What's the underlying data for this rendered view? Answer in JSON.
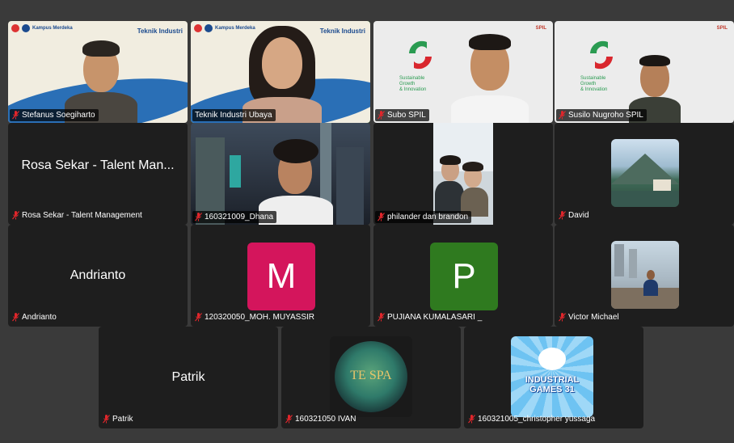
{
  "participants": [
    {
      "name": "Stefanus Soegiharto",
      "muted": true
    },
    {
      "name": "Teknik Industri Ubaya",
      "muted": false
    },
    {
      "name": "Subo SPIL",
      "muted": true
    },
    {
      "name": "Susilo Nugroho SPIL",
      "muted": true
    },
    {
      "name": "Rosa Sekar - Talent Management",
      "display": "Rosa Sekar - Talent Man...",
      "muted": true
    },
    {
      "name": "160321009_Dhana",
      "muted": true
    },
    {
      "name": "philander dan brandon",
      "muted": true
    },
    {
      "name": "David",
      "muted": true
    },
    {
      "name": "Andrianto",
      "display": "Andrianto",
      "muted": true
    },
    {
      "name": "120320050_MOH. MUYASSIR",
      "initial": "M",
      "muted": true
    },
    {
      "name": "PUJIANA KUMALASARI _",
      "initial": "P",
      "muted": true
    },
    {
      "name": "Victor Michael",
      "muted": true
    },
    {
      "name": "Patrik",
      "display": "Patrik",
      "muted": true
    },
    {
      "name": "160321050 IVAN",
      "muted": true
    },
    {
      "name": "160321005_christopher yussaga",
      "muted": true
    }
  ],
  "backdrop": {
    "brand": "Teknik Industri",
    "logo_text": "Kampus Merdeka",
    "sg_text_lines": [
      "Sustainable",
      "Growth",
      "& Innovation"
    ],
    "spil_mark": "SPIL"
  },
  "avatar_images": {
    "ivan_logo": "TE SPA",
    "games_line1": "INDUSTRIAL",
    "games_line2": "GAMES 31"
  },
  "colors": {
    "background": "#3a3a3a",
    "tile": "#1e1e1e",
    "active_speaker": "#1fbf3a",
    "muted_icon": "#e0262b",
    "avatar_m": "#d4155c",
    "avatar_p": "#2f7a1f"
  },
  "icons": {
    "muted": "mic-muted-icon"
  }
}
